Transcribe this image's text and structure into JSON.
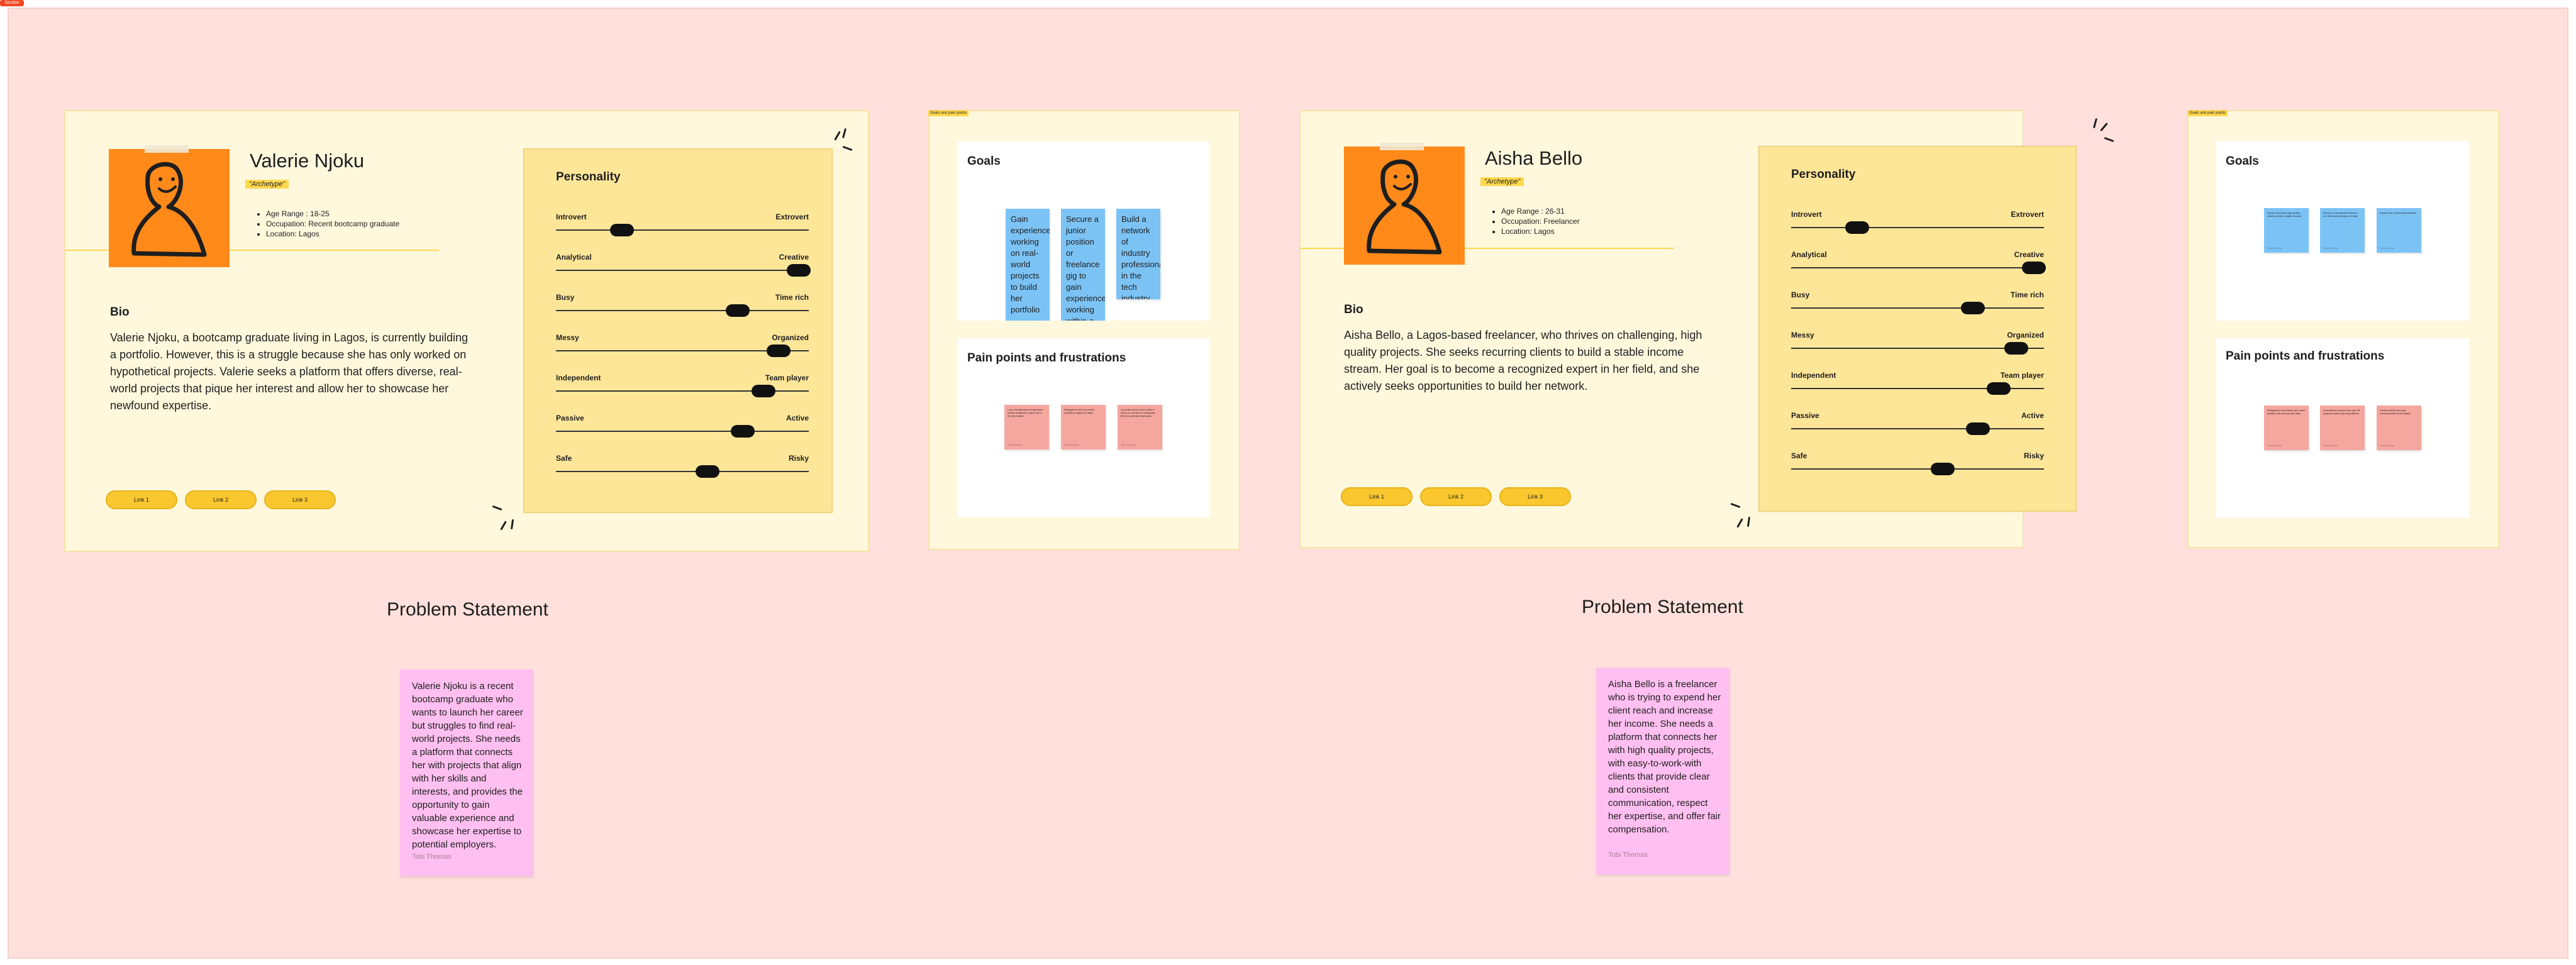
{
  "section": {
    "tag": "Section"
  },
  "personas": [
    {
      "name": "Valerie Njoku",
      "archetype": "\"Archetype\"",
      "facts": [
        "Age Range : 18-25",
        "Occupation: Recent bootcamp graduate",
        "Location: Lagos"
      ],
      "bio_heading": "Bio",
      "bio": "Valerie Njoku, a bootcamp graduate living in Lagos, is currently building a portfolio. However, this is a struggle because she has only worked on hypothetical projects. Valerie seeks a platform that offers diverse, real-world projects that pique her interest and allow her to showcase her newfound expertise.",
      "links": [
        "Link 1",
        "Link 2",
        "Link 3"
      ],
      "personality": {
        "title": "Personality",
        "traits": [
          {
            "left": "Introvert",
            "right": "Extrovert",
            "value": 0.26
          },
          {
            "left": "Analytical",
            "right": "Creative",
            "value": 0.96
          },
          {
            "left": "Busy",
            "right": "Time rich",
            "value": 0.72
          },
          {
            "left": "Messy",
            "right": "Organized",
            "value": 0.88
          },
          {
            "left": "Independent",
            "right": "Team player",
            "value": 0.82
          },
          {
            "left": "Passive",
            "right": "Active",
            "value": 0.74
          },
          {
            "left": "Safe",
            "right": "Risky",
            "value": 0.6
          }
        ]
      }
    },
    {
      "name": "Aisha Bello",
      "archetype": "\"Archetype\"",
      "facts": [
        "Age Range : 26-31",
        "Occupation: Freelancer",
        "Location: Lagos"
      ],
      "bio_heading": "Bio",
      "bio": "Aisha Bello, a Lagos-based freelancer, who thrives on challenging, high quality projects. She seeks recurring clients to build a stable income stream. Her goal is to become a recognized expert in her field, and she actively seeks opportunities to build her network.",
      "links": [
        "Link 1",
        "Link 2",
        "Link 3"
      ],
      "personality": {
        "title": "Personality",
        "traits": [
          {
            "left": "Introvert",
            "right": "Extrovert",
            "value": 0.26
          },
          {
            "left": "Analytical",
            "right": "Creative",
            "value": 0.96
          },
          {
            "left": "Busy",
            "right": "Time rich",
            "value": 0.72
          },
          {
            "left": "Messy",
            "right": "Organized",
            "value": 0.89
          },
          {
            "left": "Independent",
            "right": "Team player",
            "value": 0.82
          },
          {
            "left": "Passive",
            "right": "Active",
            "value": 0.74
          },
          {
            "left": "Safe",
            "right": "Risky",
            "value": 0.6
          }
        ]
      }
    }
  ],
  "boards": [
    {
      "tag": "Goals and pain points",
      "goals_heading": "Goals",
      "goals": [
        {
          "text": "Gain experience working on real-world projects to build her portfolio"
        },
        {
          "text": "Secure a junior position or freelance gig to gain experience working within a structured environment"
        },
        {
          "text": "Build a network of industry professionals in the tech industry"
        }
      ],
      "pains_heading": "Pain points and frustrations",
      "pains": [
        {
          "text": "Lack of professional experience makes it difficult to stand out in the job market",
          "author": "Tobi Thomas"
        },
        {
          "text": "Struggles to find real-world projects to apply her skills",
          "author": "Tobi Thomas"
        },
        {
          "text": "Uncertain about which skills to focus on and how to showcase them to potential employers",
          "author": "Tobi Thomas"
        }
      ]
    },
    {
      "tag": "Goals and pain points",
      "goals_heading": "Goals",
      "goals": [
        {
          "text": "Secure recurring, high-quality clients to build a stable income",
          "author": "Tobi Thomas"
        },
        {
          "text": "Become a recognized expert in her field and increase her rates",
          "author": "Tobi Thomas"
        },
        {
          "text": "Expand her professional network",
          "author": "Tobi Thomas"
        }
      ],
      "pains_heading": "Pain points and frustrations",
      "pains": [
        {
          "text": "Struggles to find clients who value quality work and pay fair rates",
          "author": "Tobi Thomas"
        },
        {
          "text": "Inconsistent income from one-off projects makes planning difficult",
          "author": "Tobi Thomas"
        },
        {
          "text": "Unclear briefs and poor communication from clients",
          "author": "Tobi Thomas"
        }
      ]
    }
  ],
  "problems": [
    {
      "heading": "Problem Statement",
      "text": "Valerie Njoku is a recent bootcamp graduate who wants to launch her career but struggles to find real-world projects. She needs a platform that connects her with projects that align with her skills and interests, and provides the opportunity to gain valuable experience and showcase her expertise to potential employers.",
      "author": "Tobi Thomas"
    },
    {
      "heading": "Problem Statement",
      "text": "Aisha Bello is a freelancer who is trying to expend her client reach and increase her income. She needs a platform that connects her with high quality projects, with easy-to-work-with clients that provide clear and consistent communication, respect her expertise, and offer fair compensation.",
      "author": "Tobi Thomas"
    }
  ]
}
